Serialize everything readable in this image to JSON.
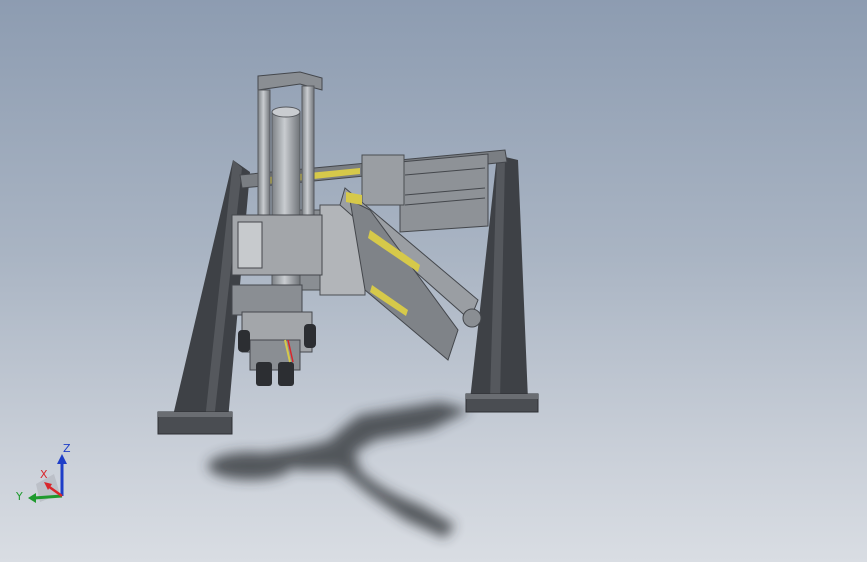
{
  "viewport": {
    "background_top": "#8d9cb1",
    "background_bottom": "#d9dde3"
  },
  "model": {
    "frame_color": "#4a4d52",
    "part_color": "#9a9ea3",
    "part_dark": "#6b6f74",
    "rail_color": "#d6c94a",
    "shadow_color": "#2b2d31"
  },
  "triad": {
    "x_label": "X",
    "y_label": "Y",
    "z_label": "Z",
    "x_color": "#d9262b",
    "y_color": "#1f9a2e",
    "z_color": "#1e3ec8"
  }
}
